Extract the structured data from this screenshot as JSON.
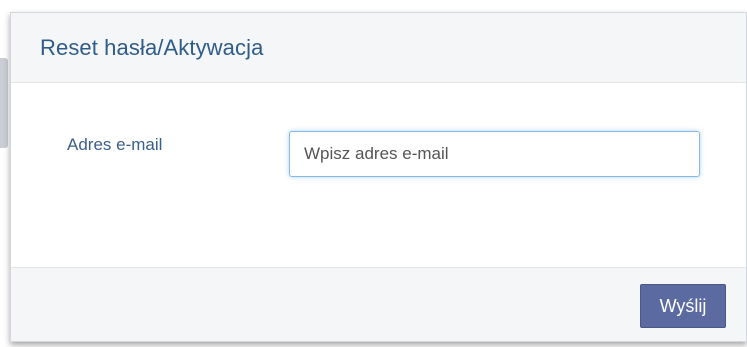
{
  "dialog": {
    "title": "Reset hasła/Aktywacja"
  },
  "form": {
    "email_label": "Adres e-mail",
    "email_value": "",
    "email_placeholder": "Wpisz adres e-mail"
  },
  "footer": {
    "submit_label": "Wyślij"
  },
  "colors": {
    "title": "#2f5c8a",
    "label": "#3a5f8a",
    "button": "#5b6aa0",
    "input_focus": "#8ab9e6",
    "header_bg": "#f5f6f7"
  }
}
